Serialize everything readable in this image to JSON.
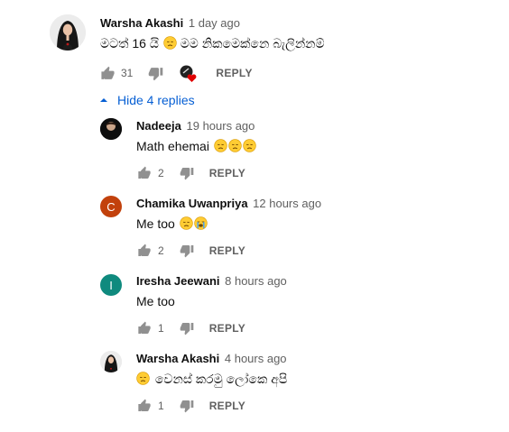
{
  "top_comment": {
    "author": "Warsha Akashi",
    "time": "1 day ago",
    "text": "මටත් 16 යි",
    "text_after": "මම නිකමෙක්නෙ බැලින්නම්",
    "likes": "31",
    "reply_label": "REPLY"
  },
  "replies_toggle": {
    "label": "Hide 4 replies"
  },
  "replies": [
    {
      "author": "Nadeeja",
      "time": "19 hours ago",
      "text": "Math ehemai",
      "likes": "2",
      "reply_label": "REPLY",
      "avatar_text": "Nadeeja"
    },
    {
      "author": "Chamika Uwanpriya",
      "time": "12 hours ago",
      "text": "Me too",
      "likes": "2",
      "reply_label": "REPLY",
      "avatar_letter": "C",
      "avatar_color": "#c2410c"
    },
    {
      "author": "Iresha Jeewani",
      "time": "8 hours ago",
      "text": "Me too",
      "likes": "1",
      "reply_label": "REPLY",
      "avatar_letter": "I",
      "avatar_color": "#0f8a7e"
    },
    {
      "author": "Warsha Akashi",
      "time": "4 hours ago",
      "text": "වෙනස් කරමු ලෝකෙ අපි",
      "likes": "1",
      "reply_label": "REPLY"
    }
  ],
  "colors": {
    "link": "#065fd4",
    "muted": "#606060",
    "heart": "#e00000"
  }
}
